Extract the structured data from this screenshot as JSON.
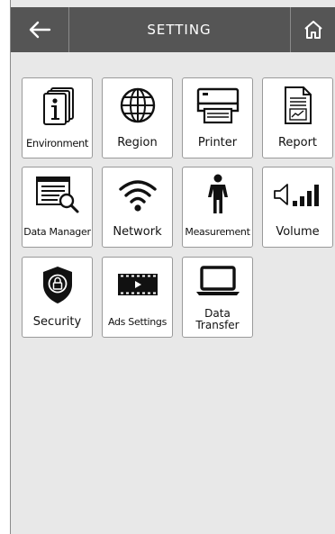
{
  "header": {
    "title": "SETTING",
    "back_icon": "left-arrow-icon",
    "home_icon": "home-icon",
    "bar_color": "#555555"
  },
  "tiles": [
    {
      "label": "Environment",
      "icon": "info-icon"
    },
    {
      "label": "Region",
      "icon": "globe-icon"
    },
    {
      "label": "Printer",
      "icon": "printer-icon"
    },
    {
      "label": "Report",
      "icon": "report-document-icon"
    },
    {
      "label": "Data Manager",
      "icon": "data-search-icon"
    },
    {
      "label": "Network",
      "icon": "wifi-icon"
    },
    {
      "label": "Measurement",
      "icon": "person-icon"
    },
    {
      "label": "Volume",
      "icon": "volume-icon"
    },
    {
      "label": "Security",
      "icon": "shield-lock-icon"
    },
    {
      "label": "Ads Settings",
      "icon": "video-play-icon"
    },
    {
      "label": "Data Transfer",
      "icon": "laptop-icon"
    }
  ]
}
